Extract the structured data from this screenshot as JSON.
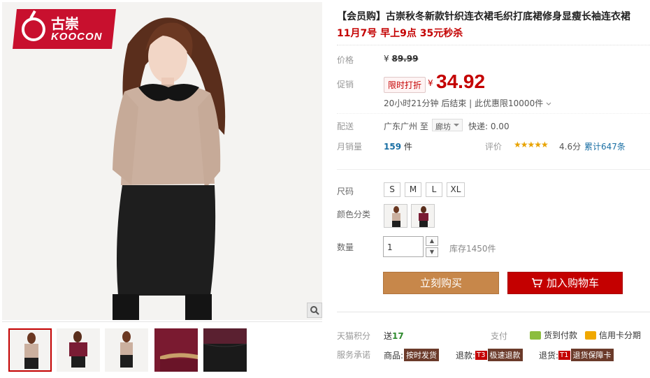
{
  "brand": {
    "cn": "古崇",
    "en": "KOOCON",
    "color": "#c8102e"
  },
  "product": {
    "title": "【会员购】古崇秋冬新款针织连衣裙毛织打底裙修身显瘦长袖连衣裙",
    "subtitle": "11月7号 早上9点 35元秒杀"
  },
  "price": {
    "label": "价格",
    "currency": "¥",
    "original": "89.99",
    "promo_label": "促销",
    "promo_tag": "限时打折",
    "promo_price": "34.92",
    "countdown": "20小时21分钟 后结束 | 此优惠限10000件",
    "accent": "#c40000"
  },
  "shipping": {
    "label": "配送",
    "from": "广东广州 至",
    "to": "廊坊",
    "fee": "快递: 0.00"
  },
  "sales": {
    "label": "月销量",
    "count": "159",
    "unit": "件",
    "rating_label": "评价",
    "stars": "★★★★★",
    "rating_score": "4.6分",
    "review_count": "累计647条"
  },
  "options": {
    "size_label": "尺码",
    "sizes": [
      "S",
      "M",
      "L",
      "XL"
    ],
    "color_label": "颜色分类",
    "colors": [
      "beige-sweater",
      "wine-red-sweater"
    ]
  },
  "quantity": {
    "label": "数量",
    "value": "1",
    "stock": "库存1450件"
  },
  "actions": {
    "buy_now": "立刻购买",
    "add_to_cart": "加入购物车"
  },
  "points": {
    "label": "天猫积分",
    "value_prefix": "送",
    "value": "17"
  },
  "payment": {
    "label": "支付",
    "items": [
      "货到付款",
      "信用卡分期"
    ]
  },
  "service": {
    "label": "服务承诺",
    "items": [
      {
        "prefix": "商品:",
        "code": "",
        "tag": "按时发货"
      },
      {
        "prefix": "退款:",
        "code": "T3",
        "tag": "极速退款"
      },
      {
        "prefix": "退货:",
        "code": "T1",
        "tag": "退货保障卡"
      }
    ]
  },
  "icons": [
    "zoom-icon",
    "cart-icon",
    "cod-icon",
    "credit-card-icon",
    "qty-up-icon",
    "qty-down-icon",
    "dropdown-icon"
  ]
}
